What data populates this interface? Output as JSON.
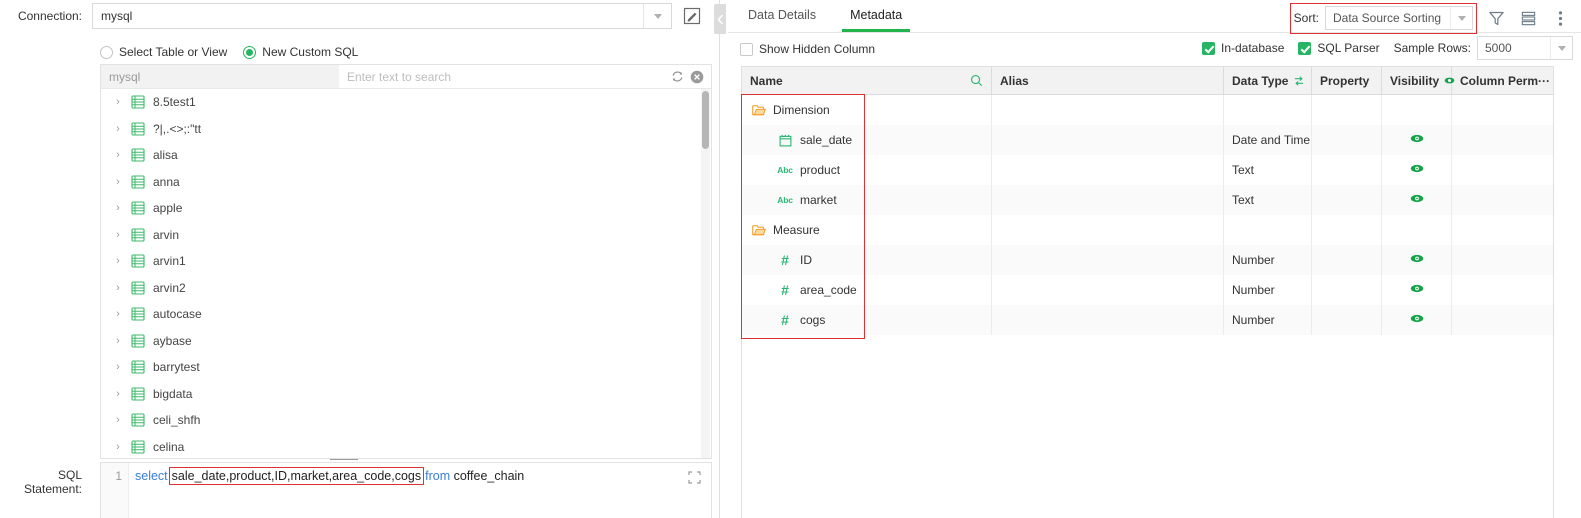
{
  "left": {
    "connection_label": "Connection:",
    "connection_value": "mysql",
    "edit_icon": "edit-pencil-icon",
    "radios": [
      {
        "label": "Select Table or View",
        "selected": false
      },
      {
        "label": "New Custom SQL",
        "selected": true
      }
    ],
    "tree_header": {
      "db_name": "mysql",
      "search_placeholder": "Enter text to search",
      "refresh_icon": "refresh-icon",
      "clear_icon": "clear-circle-icon"
    },
    "tree_items": [
      "8.5test1",
      "?|,.<>;:\"tt",
      "alisa",
      "anna",
      "apple",
      "arvin",
      "arvin1",
      "arvin2",
      "autocase",
      "aybase",
      "barrytest",
      "bigdata",
      "celi_shfh",
      "celina"
    ],
    "sql": {
      "label": "SQL Statement:",
      "line_number": "1",
      "keyword_select": "select",
      "highlighted_columns": "sale_date,product,ID,market,area_code,cogs",
      "keyword_from": "from",
      "table": "coffee_chain",
      "expand_icon": "fullscreen-expand-icon"
    }
  },
  "divider": {
    "collapse_icon": "chevron-left-icon"
  },
  "right": {
    "tabs": [
      {
        "label": "Data Details",
        "active": false
      },
      {
        "label": "Metadata",
        "active": true
      }
    ],
    "sort": {
      "label": "Sort:",
      "value": "Data Source Sorting"
    },
    "toolbar_icons": [
      "filter-funnel-icon",
      "list-rows-icon",
      "more-vertical-icon"
    ],
    "options": {
      "show_hidden_column": {
        "label": "Show Hidden Column",
        "checked": false
      },
      "in_database": {
        "label": "In-database",
        "checked": true
      },
      "sql_parser": {
        "label": "SQL Parser",
        "checked": true
      },
      "sample_rows_label": "Sample Rows:",
      "sample_rows_value": "5000"
    },
    "grid": {
      "columns": [
        {
          "label": "Name",
          "icon": "search-icon"
        },
        {
          "label": "Alias",
          "icon": ""
        },
        {
          "label": "Data Type",
          "icon": "swap-sort-icon"
        },
        {
          "label": "Property",
          "icon": ""
        },
        {
          "label": "Visibility",
          "icon": "eye-icon"
        },
        {
          "label": "Column Perm···",
          "icon": ""
        }
      ],
      "rows": [
        {
          "name": "Dimension",
          "kind": "folder",
          "indent": 0,
          "alias": "",
          "data_type": "",
          "property": "",
          "visible": false
        },
        {
          "name": "sale_date",
          "kind": "date",
          "indent": 1,
          "alias": "",
          "data_type": "Date and Time",
          "property": "",
          "visible": true
        },
        {
          "name": "product",
          "kind": "text",
          "indent": 1,
          "alias": "",
          "data_type": "Text",
          "property": "",
          "visible": true
        },
        {
          "name": "market",
          "kind": "text",
          "indent": 1,
          "alias": "",
          "data_type": "Text",
          "property": "",
          "visible": true
        },
        {
          "name": "Measure",
          "kind": "folder",
          "indent": 0,
          "alias": "",
          "data_type": "",
          "property": "",
          "visible": false
        },
        {
          "name": "ID",
          "kind": "number",
          "indent": 1,
          "alias": "",
          "data_type": "Number",
          "property": "",
          "visible": true
        },
        {
          "name": "area_code",
          "kind": "number",
          "indent": 1,
          "alias": "",
          "data_type": "Number",
          "property": "",
          "visible": true
        },
        {
          "name": "cogs",
          "kind": "number",
          "indent": 1,
          "alias": "",
          "data_type": "Number",
          "property": "",
          "visible": true
        }
      ]
    }
  },
  "colors": {
    "accent_green": "#26b562",
    "highlight_red": "#e03131",
    "keyword_blue": "#3a7fd5",
    "folder_orange": "#f5a623"
  }
}
